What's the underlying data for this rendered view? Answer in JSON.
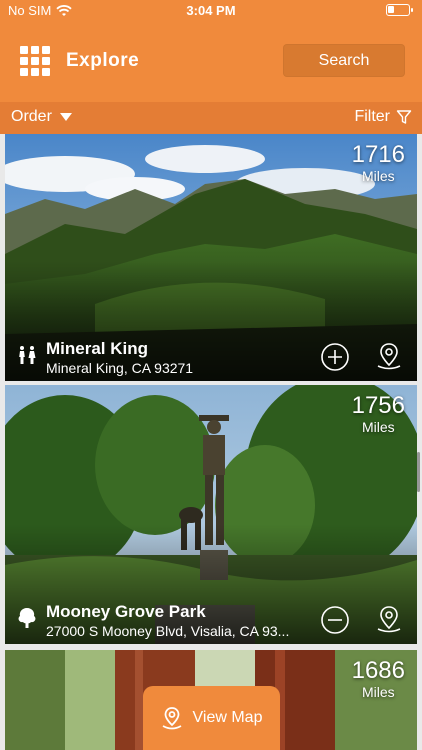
{
  "status": {
    "carrier": "No SIM",
    "time": "3:04 PM",
    "battery_level": 0.3
  },
  "header": {
    "title": "Explore",
    "search_label": "Search",
    "menu_icon": "grid-icon"
  },
  "toolbar": {
    "order_label": "Order",
    "filter_label": "Filter"
  },
  "cards": [
    {
      "distance": "1716",
      "unit": "Miles",
      "name": "Mineral King",
      "address": "Mineral King, CA 93271",
      "category_icon": "family-icon",
      "action_icon": "add-icon",
      "map_icon": "location-pin-icon"
    },
    {
      "distance": "1756",
      "unit": "Miles",
      "name": "Mooney Grove Park",
      "address": "27000 S Mooney Blvd, Visalia, CA 93...",
      "category_icon": "tree-icon",
      "action_icon": "remove-icon",
      "map_icon": "location-pin-icon"
    },
    {
      "distance": "1686",
      "unit": "Miles"
    }
  ],
  "view_map": {
    "label": "View Map"
  },
  "colors": {
    "primary": "#f08a3c",
    "toolbar": "#e47d35",
    "search_button": "#d87a30"
  }
}
